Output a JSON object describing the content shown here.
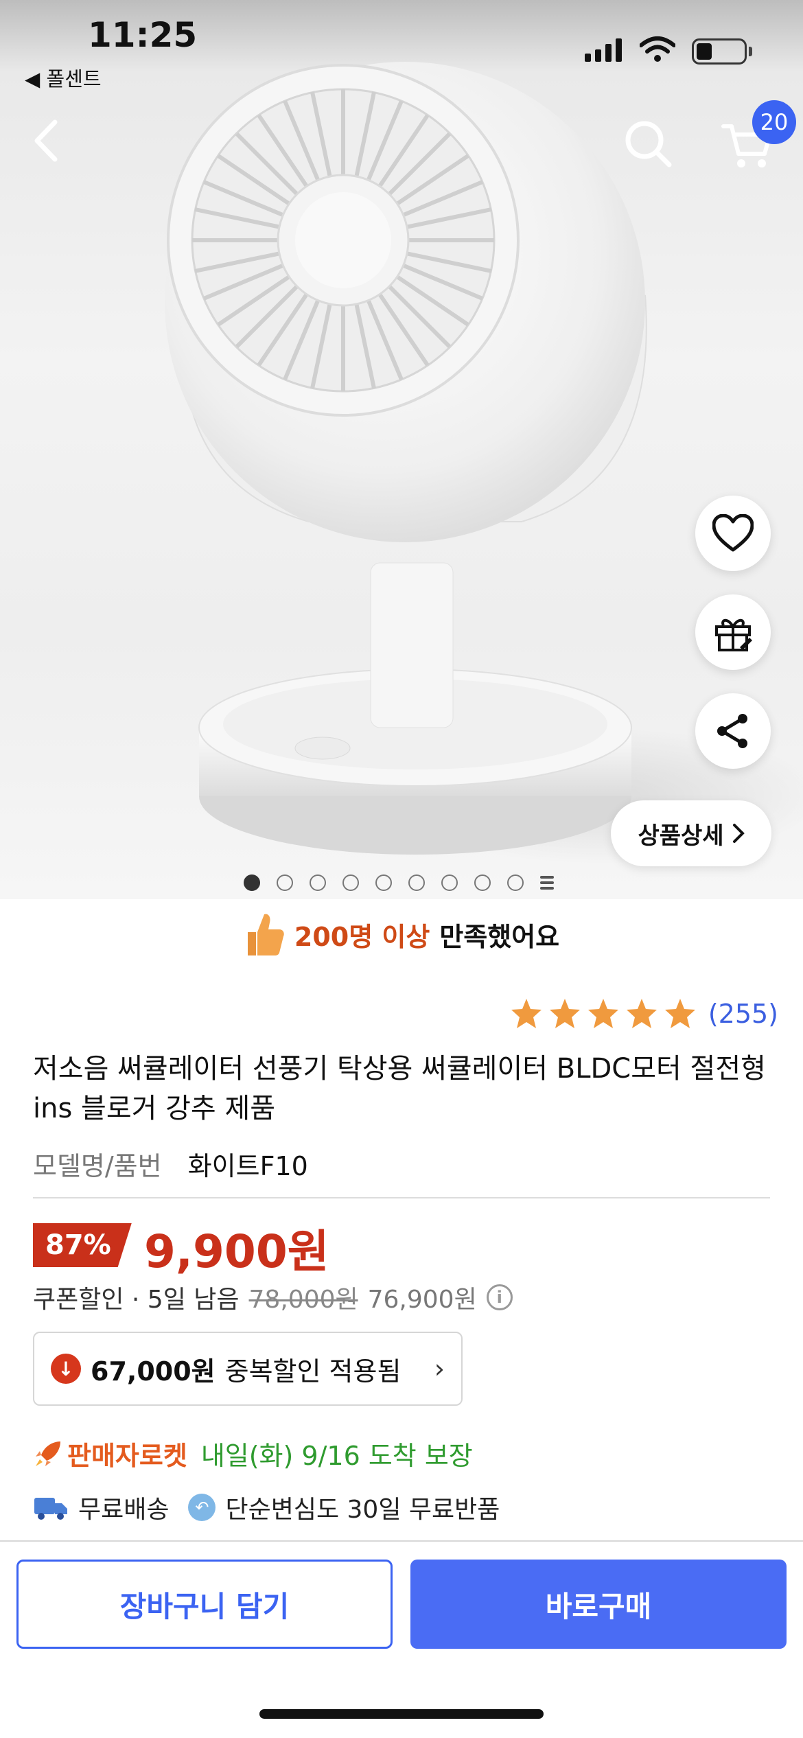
{
  "status_bar": {
    "time": "11:25",
    "back_app": "◀ 폴센트"
  },
  "nav": {
    "cart_count": "20"
  },
  "hero": {
    "detail_button": "상품상세",
    "page_dots": 9
  },
  "satisfaction": {
    "highlight": "200명 이상",
    "suffix": "만족했어요"
  },
  "rating": {
    "stars": 5,
    "count": "(255)"
  },
  "product": {
    "title": "저소음 써큘레이터 선풍기 탁상용 써큘레이터 BLDC모터 절전형 ins 블로거 강추 제품",
    "model_label": "모델명/품번",
    "model_value": "화이트F10"
  },
  "price": {
    "discount": "87%",
    "final": "9,900원",
    "coupon_label": "쿠폰할인 · 5일 남음",
    "original_strike": "78,000원",
    "before_coupon": "76,900원"
  },
  "duplicate_discount": {
    "amount": "67,000원",
    "text": "중복할인 적용됨"
  },
  "delivery": {
    "rocket_label": "판매자로켓",
    "arrival": "내일(화) 9/16 도착 보장",
    "free_shipping": "무료배송",
    "free_return": "단순변심도 30일 무료반품"
  },
  "actions": {
    "add_to_cart": "장바구니 담기",
    "buy_now": "바로구매"
  },
  "colors": {
    "accent_blue": "#4a6cf4",
    "price_red": "#c9301a",
    "rocket_orange": "#e45b1e",
    "arrival_green": "#2f9b2f"
  }
}
